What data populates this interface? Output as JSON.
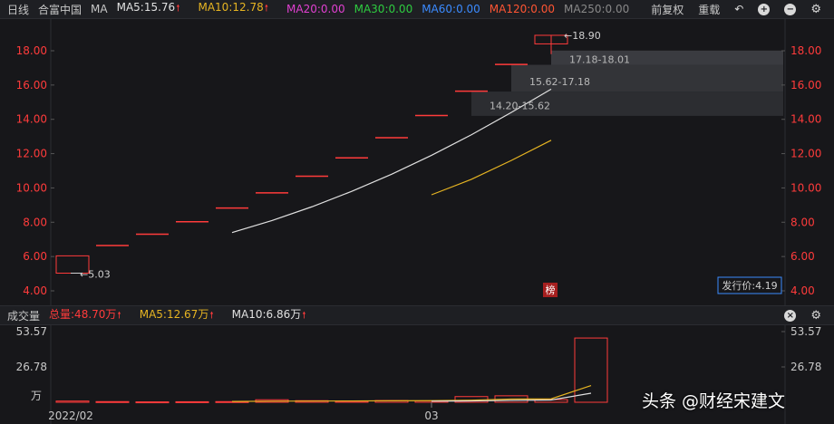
{
  "header": {
    "period": "日线",
    "stock_name": "合富中国",
    "ma_label": "MA",
    "ma5": "MA5:15.76",
    "ma10": "MA10:12.78",
    "ma20": "MA20:0.00",
    "ma30": "MA30:0.00",
    "ma60": "MA60:0.00",
    "ma120": "MA120:0.00",
    "ma250": "MA250:0.00",
    "adjust": "前复权",
    "reload": "重载"
  },
  "colors": {
    "background": "#17171a",
    "up": "#ff3b3b",
    "ma5": "#e0e0e0",
    "ma10": "#e6b422",
    "ma20": "#e040d0",
    "ma30": "#2ecc40",
    "ma60": "#3b8bff",
    "ma120": "#ff5533",
    "ma250": "#888888"
  },
  "price_panel": {
    "ticks": [
      "18.00",
      "16.00",
      "14.00",
      "12.00",
      "10.00",
      "8.00",
      "6.00",
      "4.00"
    ],
    "low_label": "5.03",
    "high_label": "18.90",
    "chip_ranges": [
      "17.18-18.01",
      "15.62-17.18",
      "14.20-15.62"
    ],
    "issue_price": "发行价:4.19",
    "rank_badge": "榜"
  },
  "volume_bar": {
    "title": "成交量",
    "total": "总量:48.70万",
    "ma5": "MA5:12.67万",
    "ma10": "MA10:6.86万"
  },
  "volume_panel": {
    "ticks": [
      "53.57",
      "26.78"
    ],
    "unit": "万",
    "dates": [
      "2022/02",
      "03"
    ]
  },
  "watermark": "头条 @财经宋建文",
  "chart_data": {
    "type": "candlestick",
    "y_range": [
      3.5,
      19.5
    ],
    "candles": [
      {
        "open": 6.04,
        "close": 5.03,
        "high": 6.04,
        "low": 5.03
      },
      {
        "open": 6.64,
        "close": 6.64,
        "high": 6.64,
        "low": 6.64
      },
      {
        "open": 7.3,
        "close": 7.3,
        "high": 7.3,
        "low": 7.3
      },
      {
        "open": 8.03,
        "close": 8.03,
        "high": 8.03,
        "low": 8.03
      },
      {
        "open": 8.83,
        "close": 8.83,
        "high": 8.83,
        "low": 8.83
      },
      {
        "open": 9.71,
        "close": 9.71,
        "high": 9.71,
        "low": 9.71
      },
      {
        "open": 10.68,
        "close": 10.68,
        "high": 10.68,
        "low": 10.68
      },
      {
        "open": 11.75,
        "close": 11.75,
        "high": 11.75,
        "low": 11.75
      },
      {
        "open": 12.93,
        "close": 12.93,
        "high": 12.93,
        "low": 12.93
      },
      {
        "open": 14.22,
        "close": 14.22,
        "high": 14.22,
        "low": 14.22
      },
      {
        "open": 15.64,
        "close": 15.64,
        "high": 15.64,
        "low": 15.64
      },
      {
        "open": 17.2,
        "close": 17.2,
        "high": 17.2,
        "low": 17.2
      },
      {
        "open": 18.4,
        "close": 18.9,
        "high": 18.9,
        "low": 17.8
      }
    ],
    "ma5_line": [
      null,
      null,
      null,
      null,
      7.4,
      8.1,
      8.9,
      9.8,
      10.8,
      11.9,
      13.1,
      14.4,
      15.76
    ],
    "ma10_line": [
      null,
      null,
      null,
      null,
      null,
      null,
      null,
      null,
      null,
      9.6,
      10.5,
      11.6,
      12.78
    ],
    "volume": [
      0.9,
      0.5,
      0.3,
      0.4,
      0.5,
      1.9,
      1.2,
      0.8,
      1.3,
      1.0,
      4.3,
      4.9,
      2.0,
      48.7
    ],
    "volume_ma5": [
      null,
      null,
      null,
      null,
      0.6,
      0.8,
      0.9,
      1.0,
      1.1,
      1.2,
      1.6,
      2.4,
      2.6,
      12.67
    ],
    "volume_ma10": [
      null,
      null,
      null,
      null,
      null,
      null,
      null,
      null,
      null,
      0.8,
      1.0,
      1.4,
      1.7,
      6.86
    ],
    "volume_range": [
      0,
      53.57
    ]
  }
}
